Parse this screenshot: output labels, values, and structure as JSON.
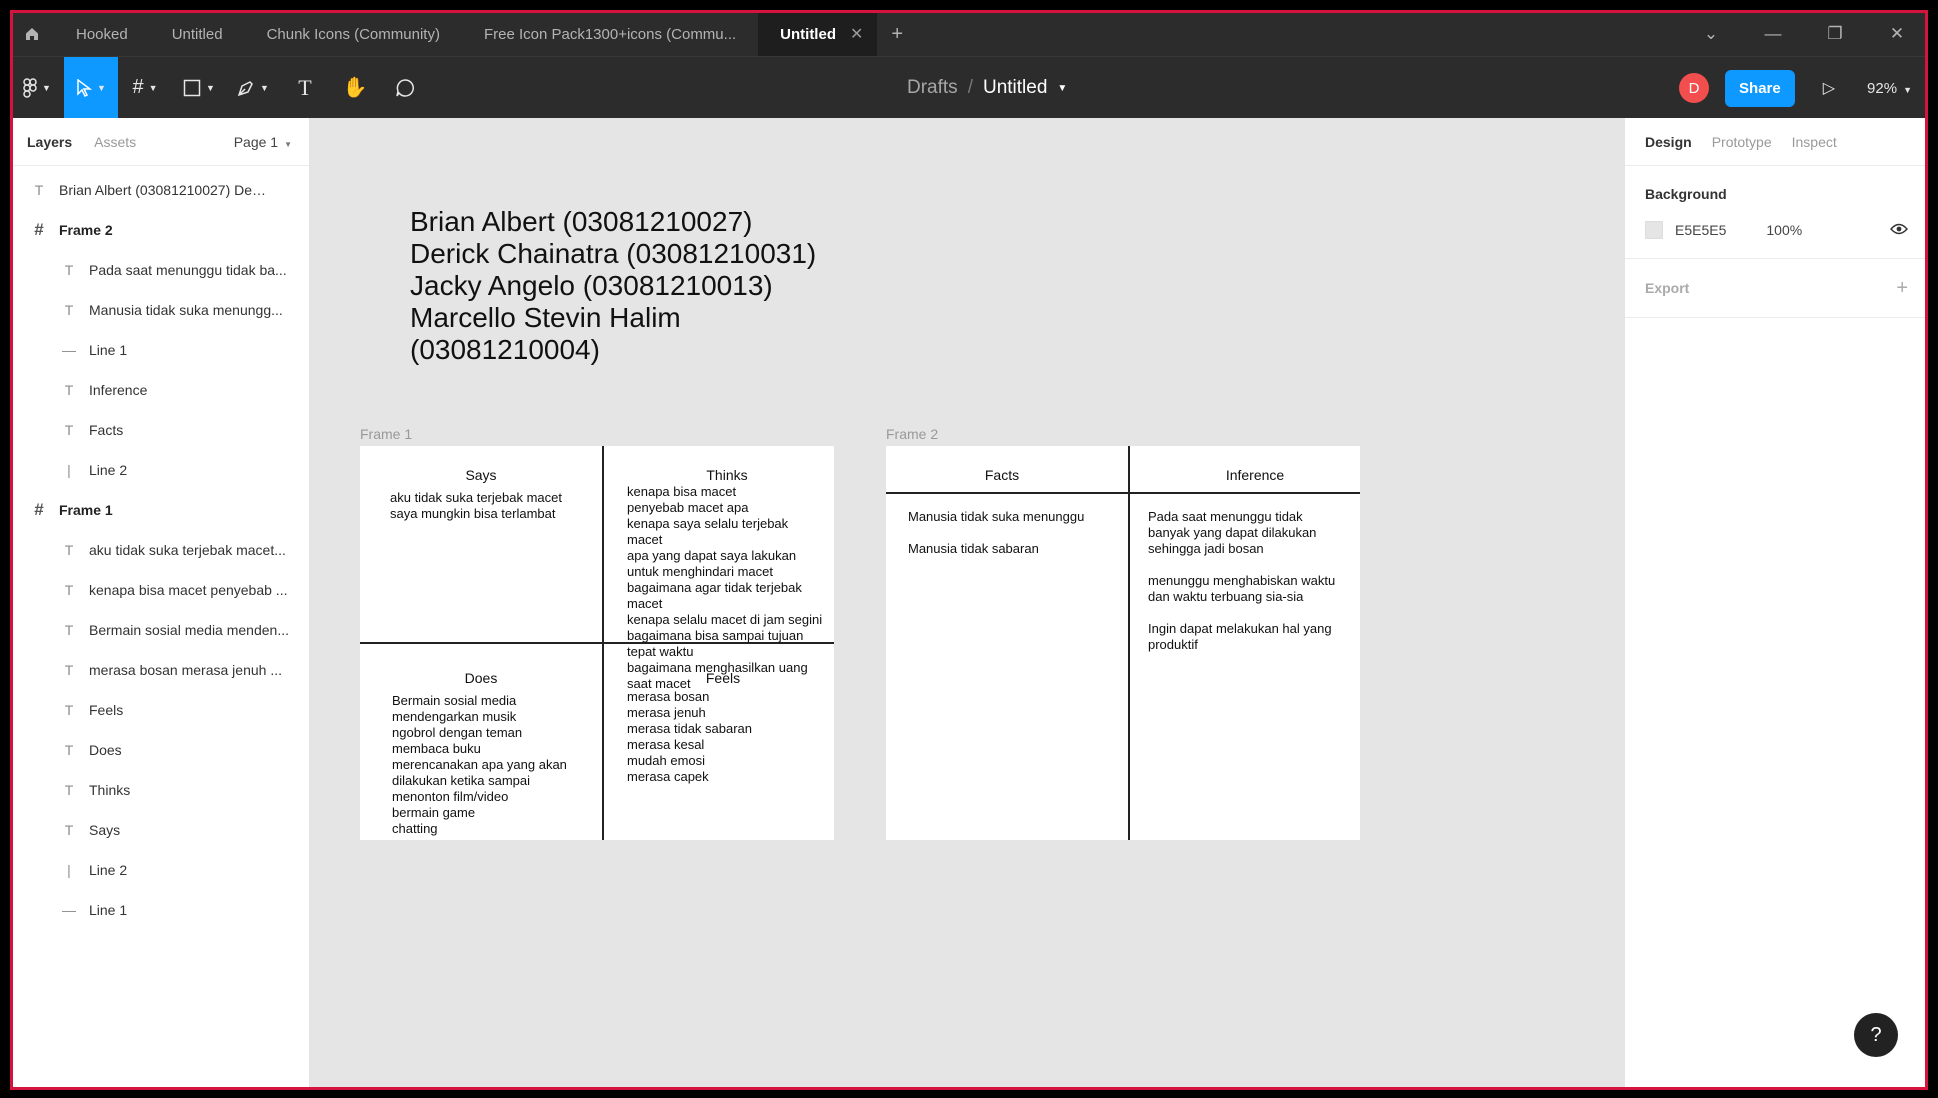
{
  "tabs": [
    {
      "label": "Hooked"
    },
    {
      "label": "Untitled"
    },
    {
      "label": "Chunk Icons (Community)"
    },
    {
      "label": "Free Icon Pack1300+icons (Commu..."
    },
    {
      "label": "Untitled",
      "active": true
    }
  ],
  "toolbar": {
    "breadcrumb_root": "Drafts",
    "breadcrumb_sep": "/",
    "file_name": "Untitled",
    "avatar_initial": "D",
    "share_label": "Share",
    "zoom": "92%"
  },
  "left_panel": {
    "tab_layers": "Layers",
    "tab_assets": "Assets",
    "page": "Page 1",
    "layers": [
      {
        "type": "text",
        "level": 0,
        "label": "Brian Albert (03081210027) Derick..."
      },
      {
        "type": "frame",
        "level": 0,
        "label": "Frame 2"
      },
      {
        "type": "text",
        "level": 1,
        "label": "Pada saat menunggu tidak ba..."
      },
      {
        "type": "text",
        "level": 1,
        "label": "Manusia tidak suka menungg..."
      },
      {
        "type": "hline",
        "level": 1,
        "label": "Line 1"
      },
      {
        "type": "text",
        "level": 1,
        "label": "Inference"
      },
      {
        "type": "text",
        "level": 1,
        "label": "Facts"
      },
      {
        "type": "vline",
        "level": 1,
        "label": "Line 2"
      },
      {
        "type": "frame",
        "level": 0,
        "label": "Frame 1"
      },
      {
        "type": "text",
        "level": 1,
        "label": "aku tidak suka terjebak macet..."
      },
      {
        "type": "text",
        "level": 1,
        "label": "kenapa bisa macet penyebab ..."
      },
      {
        "type": "text",
        "level": 1,
        "label": "Bermain sosial media menden..."
      },
      {
        "type": "text",
        "level": 1,
        "label": "merasa bosan merasa jenuh ..."
      },
      {
        "type": "text",
        "level": 1,
        "label": "Feels"
      },
      {
        "type": "text",
        "level": 1,
        "label": "Does"
      },
      {
        "type": "text",
        "level": 1,
        "label": "Thinks"
      },
      {
        "type": "text",
        "level": 1,
        "label": "Says"
      },
      {
        "type": "vline",
        "level": 1,
        "label": "Line 2"
      },
      {
        "type": "hline",
        "level": 1,
        "label": "Line 1"
      }
    ]
  },
  "canvas": {
    "names_text": "Brian Albert (03081210027)\nDerick Chainatra (03081210031)\nJacky Angelo (03081210013)\nMarcello Stevin Halim\n(03081210004)",
    "frame1": {
      "label": "Frame 1",
      "says_title": "Says",
      "says_text": "aku tidak suka terjebak macet\nsaya mungkin bisa terlambat",
      "thinks_title": "Thinks",
      "thinks_text": "kenapa bisa macet\npenyebab macet apa\nkenapa saya selalu terjebak macet\napa yang dapat saya lakukan untuk menghindari macet\nbagaimana agar tidak terjebak macet\nkenapa selalu macet di jam segini\nbagaimana bisa sampai tujuan tepat waktu\nbagaimana menghasilkan uang saat macet",
      "does_title": "Does",
      "does_text": "Bermain sosial media\nmendengarkan musik\nngobrol dengan teman\nmembaca buku\nmerencanakan apa yang akan dilakukan ketika sampai\nmenonton film/video\nbermain game\nchatting",
      "feels_title": "Feels",
      "feels_text": "merasa bosan\nmerasa jenuh\nmerasa tidak sabaran\nmerasa kesal\nmudah emosi\nmerasa capek"
    },
    "frame2": {
      "label": "Frame 2",
      "facts_title": "Facts",
      "facts_text": "Manusia tidak suka menunggu\n\nManusia tidak sabaran",
      "inference_title": "Inference",
      "inference_text": "Pada saat menunggu tidak banyak yang dapat dilakukan sehingga jadi bosan\n\nmenunggu menghabiskan waktu dan waktu terbuang sia-sia\n\nIngin dapat melakukan hal yang produktif"
    }
  },
  "right_panel": {
    "tab_design": "Design",
    "tab_prototype": "Prototype",
    "tab_inspect": "Inspect",
    "background_heading": "Background",
    "background_hex": "E5E5E5",
    "background_opacity": "100%",
    "export_heading": "Export"
  },
  "help_label": "?",
  "colors": {
    "accent": "#0d99ff",
    "avatar": "#f24e4e",
    "canvas_bg": "#e5e5e5"
  }
}
